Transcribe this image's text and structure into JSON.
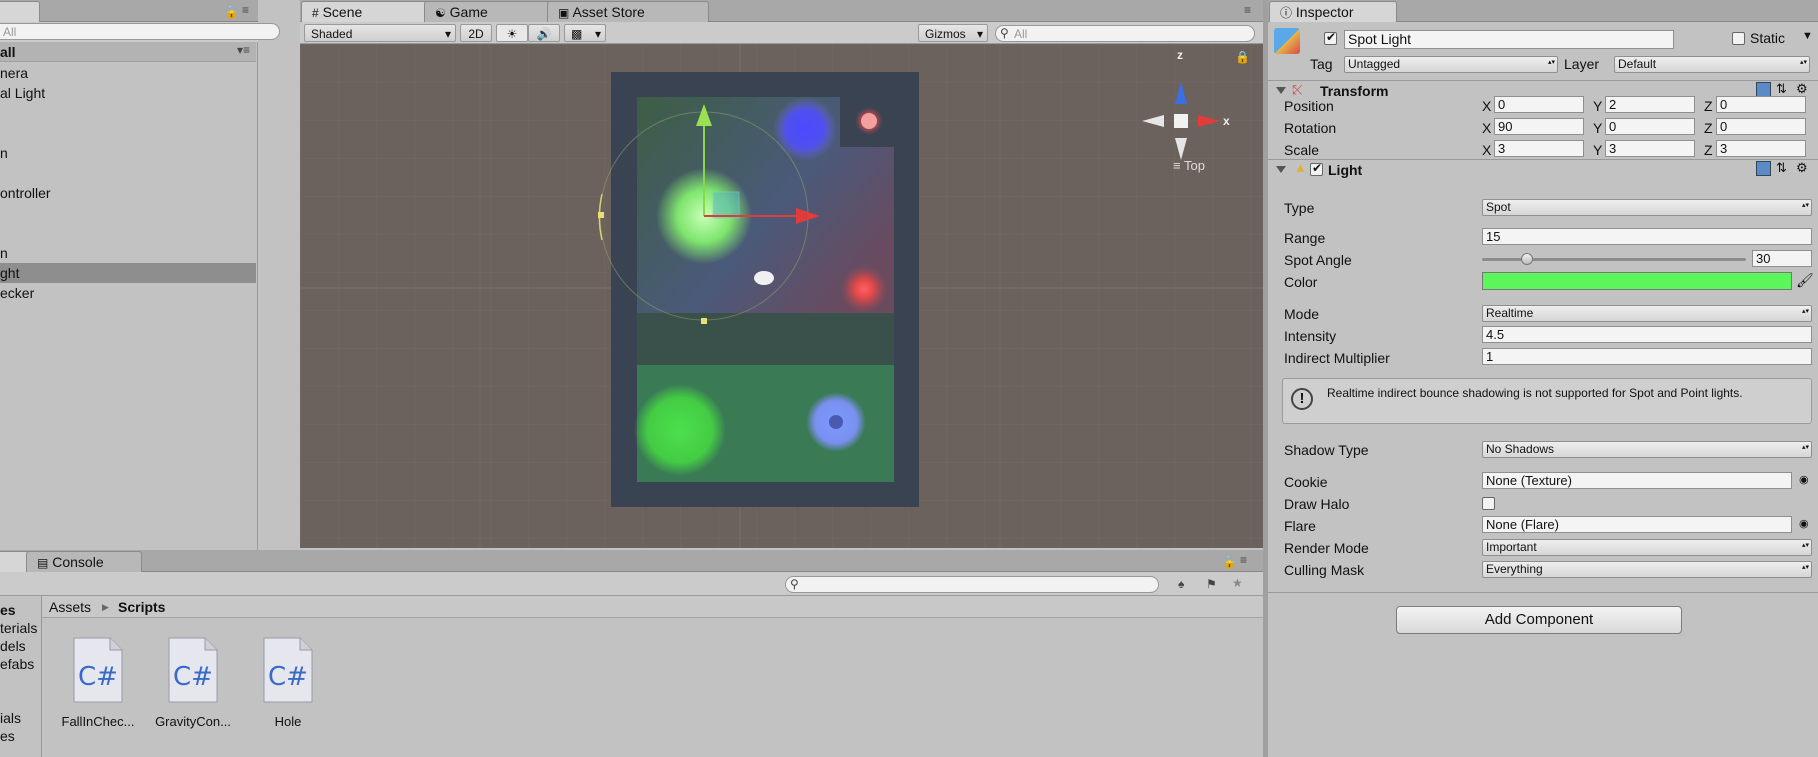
{
  "hierarchy": {
    "search_placeholder": "All",
    "scene_name": "all",
    "items": [
      {
        "label": "nera",
        "selected": false
      },
      {
        "label": "al Light",
        "selected": false
      },
      {
        "label": "",
        "selected": false
      },
      {
        "label": "",
        "selected": false
      },
      {
        "label": "n",
        "selected": false
      },
      {
        "label": "",
        "selected": false
      },
      {
        "label": "ontroller",
        "selected": false
      },
      {
        "label": "",
        "selected": false
      },
      {
        "label": "",
        "selected": false
      },
      {
        "label": "n",
        "selected": false
      },
      {
        "label": "ght",
        "selected": true
      },
      {
        "label": "ecker",
        "selected": false
      }
    ]
  },
  "scene_view": {
    "tabs": [
      "Scene",
      "Game",
      "Asset Store"
    ],
    "shading": "Shaded",
    "mode_2d": "2D",
    "gizmos": "Gizmos",
    "search_placeholder": "All",
    "orientation": "Top",
    "gizmo_axes": {
      "y": "z",
      "x": "x"
    }
  },
  "inspector": {
    "tab": "Inspector",
    "object_name": "Spot Light",
    "static_label": "Static",
    "tag_label": "Tag",
    "tag_value": "Untagged",
    "layer_label": "Layer",
    "layer_value": "Default",
    "transform": {
      "title": "Transform",
      "position": {
        "label": "Position",
        "x": "0",
        "y": "2",
        "z": "0"
      },
      "rotation": {
        "label": "Rotation",
        "x": "90",
        "y": "0",
        "z": "0"
      },
      "scale": {
        "label": "Scale",
        "x": "3",
        "y": "3",
        "z": "3"
      }
    },
    "axis_labels": {
      "x": "X",
      "y": "Y",
      "z": "Z"
    },
    "light": {
      "title": "Light",
      "type_label": "Type",
      "type_value": "Spot",
      "range_label": "Range",
      "range_value": "15",
      "angle_label": "Spot Angle",
      "angle_value": "30",
      "angle_fraction": 0.17,
      "color_label": "Color",
      "color_value": "#5cf55c",
      "mode_label": "Mode",
      "mode_value": "Realtime",
      "intensity_label": "Intensity",
      "intensity_value": "4.5",
      "indirect_label": "Indirect Multiplier",
      "indirect_value": "1",
      "info_text": "Realtime indirect bounce shadowing is not supported for Spot and Point lights.",
      "shadow_label": "Shadow Type",
      "shadow_value": "No Shadows",
      "cookie_label": "Cookie",
      "cookie_value": "None (Texture)",
      "halo_label": "Draw Halo",
      "flare_label": "Flare",
      "flare_value": "None (Flare)",
      "render_label": "Render Mode",
      "render_value": "Important",
      "culling_label": "Culling Mask",
      "culling_value": "Everything"
    },
    "add_component": "Add Component"
  },
  "project": {
    "tabs": [
      "",
      "Console"
    ],
    "breadcrumb_root": "Assets",
    "breadcrumb_current": "Scripts",
    "folders": [
      "es",
      "terials",
      "dels",
      "efabs",
      "",
      "",
      "ials",
      "es"
    ],
    "files": [
      {
        "icon": "C#",
        "name": "FallInChec..."
      },
      {
        "icon": "C#",
        "name": "GravityCon..."
      },
      {
        "icon": "C#",
        "name": "Hole"
      }
    ]
  }
}
